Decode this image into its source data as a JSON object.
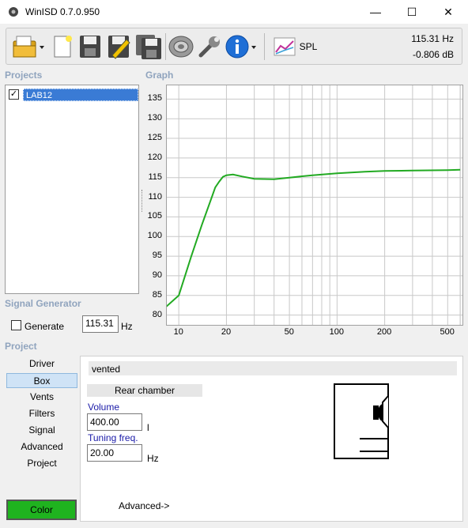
{
  "window": {
    "title": "WinISD 0.7.0.950",
    "minimize": "—",
    "maximize": "☐",
    "close": "✕"
  },
  "toolbar": {
    "icons": [
      "open-folder-icon",
      "new-document-icon",
      "save-icon",
      "edit-icon",
      "save-all-icon",
      "speaker-icon",
      "wrench-icon",
      "info-icon",
      "spl-graph-icon"
    ],
    "spl_label": "SPL",
    "freq_readout": "115.31 Hz",
    "level_readout": "-0.806 dB"
  },
  "projects": {
    "heading": "Projects",
    "items": [
      {
        "label": "LAB12",
        "checked": true
      }
    ]
  },
  "graph": {
    "heading": "Graph",
    "y_ticks": [
      "135",
      "130",
      "125",
      "120",
      "115",
      "110",
      "105",
      "100",
      "95",
      "90",
      "85",
      "80"
    ],
    "x_ticks": [
      "10",
      "20",
      "50",
      "100",
      "200",
      "500"
    ],
    "curve_color": "#22aa22",
    "curve": [
      [
        8,
        81.5
      ],
      [
        10,
        85
      ],
      [
        12,
        95
      ],
      [
        14,
        103
      ],
      [
        16,
        109.5
      ],
      [
        17,
        112.5
      ],
      [
        18,
        114
      ],
      [
        19,
        115.2
      ],
      [
        20,
        115.6
      ],
      [
        22,
        115.8
      ],
      [
        25,
        115.3
      ],
      [
        30,
        114.7
      ],
      [
        40,
        114.6
      ],
      [
        50,
        115.0
      ],
      [
        70,
        115.6
      ],
      [
        100,
        116.1
      ],
      [
        150,
        116.5
      ],
      [
        200,
        116.7
      ],
      [
        300,
        116.8
      ],
      [
        500,
        116.9
      ],
      [
        600,
        117.0
      ]
    ]
  },
  "signal_generator": {
    "heading": "Signal Generator",
    "generate_label": "Generate",
    "freq_value": "115.31",
    "freq_unit": "Hz"
  },
  "project": {
    "heading": "Project",
    "nav": [
      "Driver",
      "Box",
      "Vents",
      "Filters",
      "Signal",
      "Advanced",
      "Project"
    ],
    "active": "Box"
  },
  "box": {
    "type": "vented",
    "rear_chamber": "Rear chamber",
    "volume_label": "Volume",
    "volume_value": "400.00",
    "volume_unit": "l",
    "tuning_label": "Tuning freq.",
    "tuning_value": "20.00",
    "tuning_unit": "Hz",
    "advanced_label": "Advanced->"
  },
  "color_button": {
    "label": "Color",
    "color": "#1fb31f"
  }
}
